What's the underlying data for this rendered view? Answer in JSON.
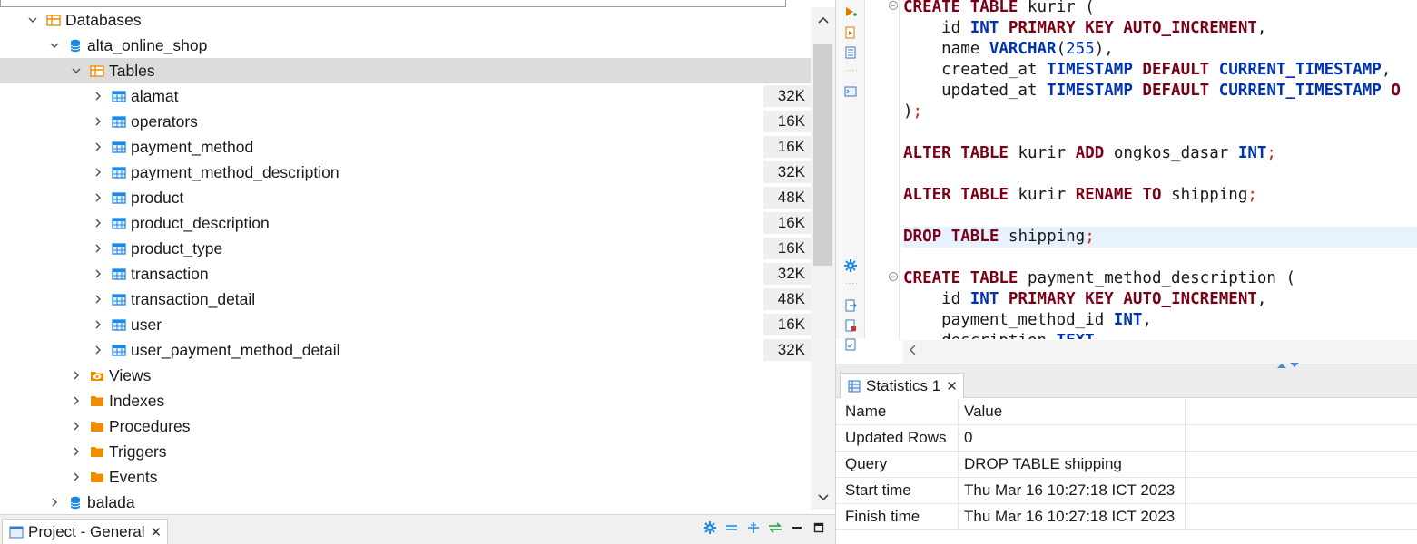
{
  "navigator": {
    "tree": [
      {
        "label": "Databases",
        "level": 1,
        "expanded": true,
        "icon": "databases-folder-icon"
      },
      {
        "label": "alta_online_shop",
        "level": 2,
        "expanded": true,
        "icon": "database-icon"
      },
      {
        "label": "Tables",
        "level": 3,
        "expanded": true,
        "icon": "tables-folder-icon",
        "selected": true
      },
      {
        "label": "alamat",
        "size": "32K",
        "level": 4,
        "icon": "table-icon"
      },
      {
        "label": "operators",
        "size": "16K",
        "level": 4,
        "icon": "table-icon"
      },
      {
        "label": "payment_method",
        "size": "16K",
        "level": 4,
        "icon": "table-icon"
      },
      {
        "label": "payment_method_description",
        "size": "32K",
        "level": 4,
        "icon": "table-icon"
      },
      {
        "label": "product",
        "size": "48K",
        "level": 4,
        "icon": "table-icon"
      },
      {
        "label": "product_description",
        "size": "16K",
        "level": 4,
        "icon": "table-icon"
      },
      {
        "label": "product_type",
        "size": "16K",
        "level": 4,
        "icon": "table-icon"
      },
      {
        "label": "transaction",
        "size": "32K",
        "level": 4,
        "icon": "table-icon"
      },
      {
        "label": "transaction_detail",
        "size": "48K",
        "level": 4,
        "icon": "table-icon"
      },
      {
        "label": "user",
        "size": "16K",
        "level": 4,
        "icon": "table-icon"
      },
      {
        "label": "user_payment_method_detail",
        "size": "32K",
        "level": 4,
        "icon": "table-icon"
      },
      {
        "label": "Views",
        "level": 3,
        "icon": "views-folder-icon"
      },
      {
        "label": "Indexes",
        "level": 3,
        "icon": "folder-icon"
      },
      {
        "label": "Procedures",
        "level": 3,
        "icon": "folder-icon"
      },
      {
        "label": "Triggers",
        "level": 3,
        "icon": "folder-icon"
      },
      {
        "label": "Events",
        "level": 3,
        "icon": "folder-icon"
      },
      {
        "label": "balada",
        "level": 2,
        "icon": "database-icon"
      }
    ]
  },
  "bottom_tab": {
    "label": "Project - General",
    "close": "✕"
  },
  "editor": {
    "lines": [
      {
        "tokens": [
          [
            "kw",
            "CREATE"
          ],
          [
            "t",
            " "
          ],
          [
            "kw",
            "TABLE"
          ],
          [
            "t",
            " kurir ("
          ]
        ],
        "fold": true
      },
      {
        "tokens": [
          [
            "t",
            "    id "
          ],
          [
            "ty",
            "INT"
          ],
          [
            "t",
            " "
          ],
          [
            "kw",
            "PRIMARY"
          ],
          [
            "t",
            " "
          ],
          [
            "kw",
            "KEY"
          ],
          [
            "t",
            " "
          ],
          [
            "kw",
            "AUTO_INCREMENT"
          ],
          [
            "t",
            ","
          ]
        ]
      },
      {
        "tokens": [
          [
            "t",
            "    name "
          ],
          [
            "ty",
            "VARCHAR"
          ],
          [
            "t",
            "("
          ],
          [
            "num",
            "255"
          ],
          [
            "t",
            "),"
          ]
        ]
      },
      {
        "tokens": [
          [
            "t",
            "    created_at "
          ],
          [
            "ty",
            "TIMESTAMP"
          ],
          [
            "t",
            " "
          ],
          [
            "kw",
            "DEFAULT"
          ],
          [
            "t",
            " "
          ],
          [
            "ty",
            "CURRENT_TIMESTAMP"
          ],
          [
            "t",
            ","
          ]
        ]
      },
      {
        "tokens": [
          [
            "t",
            "    updated_at "
          ],
          [
            "ty",
            "TIMESTAMP"
          ],
          [
            "t",
            " "
          ],
          [
            "kw",
            "DEFAULT"
          ],
          [
            "t",
            " "
          ],
          [
            "ty",
            "CURRENT_TIMESTAMP"
          ],
          [
            "t",
            " "
          ],
          [
            "kw",
            "O"
          ]
        ]
      },
      {
        "tokens": [
          [
            "t",
            ")"
          ],
          [
            "semi",
            ";"
          ]
        ]
      },
      {
        "tokens": []
      },
      {
        "tokens": [
          [
            "kw",
            "ALTER"
          ],
          [
            "t",
            " "
          ],
          [
            "kw",
            "TABLE"
          ],
          [
            "t",
            " kurir "
          ],
          [
            "kw",
            "ADD"
          ],
          [
            "t",
            " ongkos_dasar "
          ],
          [
            "ty",
            "INT"
          ],
          [
            "semi",
            ";"
          ]
        ]
      },
      {
        "tokens": []
      },
      {
        "tokens": [
          [
            "kw",
            "ALTER"
          ],
          [
            "t",
            " "
          ],
          [
            "kw",
            "TABLE"
          ],
          [
            "t",
            " kurir "
          ],
          [
            "kw",
            "RENAME"
          ],
          [
            "t",
            " "
          ],
          [
            "kw",
            "TO"
          ],
          [
            "t",
            " shipping"
          ],
          [
            "semi",
            ";"
          ]
        ]
      },
      {
        "tokens": []
      },
      {
        "tokens": [
          [
            "kw",
            "DROP"
          ],
          [
            "t",
            " "
          ],
          [
            "kw",
            "TABLE"
          ],
          [
            "t",
            " shipping"
          ],
          [
            "semi",
            ";"
          ]
        ],
        "current": true
      },
      {
        "tokens": []
      },
      {
        "tokens": [
          [
            "kw",
            "CREATE"
          ],
          [
            "t",
            " "
          ],
          [
            "kw",
            "TABLE"
          ],
          [
            "t",
            " payment_method_description ("
          ]
        ],
        "fold": true
      },
      {
        "tokens": [
          [
            "t",
            "    id "
          ],
          [
            "ty",
            "INT"
          ],
          [
            "t",
            " "
          ],
          [
            "kw",
            "PRIMARY"
          ],
          [
            "t",
            " "
          ],
          [
            "kw",
            "KEY"
          ],
          [
            "t",
            " "
          ],
          [
            "kw",
            "AUTO_INCREMENT"
          ],
          [
            "t",
            ","
          ]
        ]
      },
      {
        "tokens": [
          [
            "t",
            "    payment_method_id "
          ],
          [
            "ty",
            "INT"
          ],
          [
            "t",
            ","
          ]
        ]
      },
      {
        "tokens": [
          [
            "t",
            "    description "
          ],
          [
            "ty",
            "TEXT"
          ]
        ]
      }
    ]
  },
  "results": {
    "tab_label": "Statistics 1",
    "tab_close": "✕",
    "header": {
      "name": "Name",
      "value": "Value"
    },
    "rows": [
      {
        "name": "Updated Rows",
        "value": "0"
      },
      {
        "name": "Query",
        "value": "DROP TABLE shipping"
      },
      {
        "name": "Start time",
        "value": "Thu Mar 16 10:27:18 ICT 2023"
      },
      {
        "name": "Finish time",
        "value": "Thu Mar 16 10:27:18 ICT 2023"
      }
    ]
  },
  "colors": {
    "accent": "#1e88e5",
    "folder": "#f08c00",
    "keyword": "#7a0016",
    "type": "#0033b3"
  }
}
